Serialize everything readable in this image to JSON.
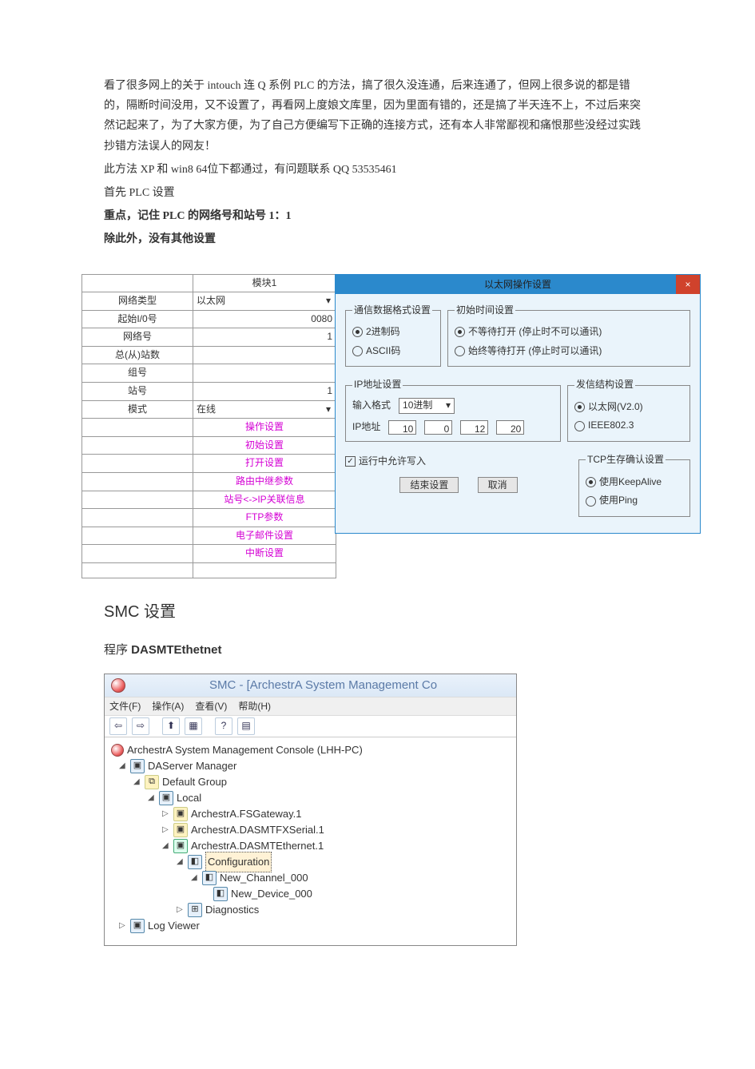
{
  "text": {
    "p1": "看了很多网上的关于 intouch 连 Q 系例 PLC 的方法，搞了很久没连通，后来连通了，但网上很多说的都是错的，隔断时间没用，又不设置了，再看网上度娘文库里，因为里面有错的，还是搞了半天连不上，不过后来突然记起来了，为了大家方便，为了自己方便编写下正确的连接方式，还有本人非常鄙视和痛恨那些没经过实践抄错方法误人的网友！",
    "p2a": "此方法 XP 和 win8",
    "p2b": "64位下都通过，有问题联系 QQ",
    "p2c": "53535461",
    "p3": "首先 PLC 设置",
    "p4": "重点，记住 PLC 的网络号和站号  1：1",
    "p5": "除此外，没有其他设置",
    "smc_h": "SMC 设置",
    "prog_pre": "程序 ",
    "prog_name": "DASMTEthetnet"
  },
  "plc": {
    "header_module": "模块1",
    "rows": {
      "net_type_lbl": "网络类型",
      "net_type_val": "以太网",
      "start_io_lbl": "起始I/0号",
      "start_io_val": "0080",
      "net_no_lbl": "网络号",
      "net_no_val": "1",
      "total_sta_lbl": "总(从)站数",
      "total_sta_val": "",
      "group_lbl": "组号",
      "group_val": "",
      "sta_lbl": "站号",
      "sta_val": "1",
      "mode_lbl": "模式",
      "mode_val": "在线"
    },
    "links": [
      "操作设置",
      "初始设置",
      "打开设置",
      "路由中继参数",
      "站号<->IP关联信息",
      "FTP参数",
      "电子邮件设置",
      "中断设置"
    ]
  },
  "dlg": {
    "title": "以太网操作设置",
    "close": "×",
    "fmt_legend": "通信数据格式设置",
    "fmt_bin": "2进制码",
    "fmt_ascii": "ASCII码",
    "init_legend": "初始时间设置",
    "init_nowait": "不等待打开 (停止时不可以通讯)",
    "init_wait": "始终等待打开 (停止时可以通讯)",
    "ip_legend": "IP地址设置",
    "ip_fmt_lbl": "输入格式",
    "ip_fmt_val": "10进制",
    "ip_lbl": "IP地址",
    "ip": [
      "10",
      "0",
      "12",
      "20"
    ],
    "send_legend": "发信结构设置",
    "send_v2": "以太网(V2.0)",
    "send_ieee": "IEEE802.3",
    "writable": "运行中允许写入",
    "tcp_legend": "TCP生存确认设置",
    "tcp_keep": "使用KeepAlive",
    "tcp_ping": "使用Ping",
    "btn_end": "结束设置",
    "btn_cancel": "取消"
  },
  "smc": {
    "title": "SMC - [ArchestrA System Management Co",
    "menu": [
      "文件(F)",
      "操作(A)",
      "查看(V)",
      "帮助(H)"
    ],
    "nodes": {
      "root": "ArchestrA System Management Console (LHH-PC)",
      "daserver": "DAServer Manager",
      "defgroup": "Default Group",
      "local": "Local",
      "fsgateway": "ArchestrA.FSGateway.1",
      "dasmtfx": "ArchestrA.DASMTFXSerial.1",
      "dasmteth": "ArchestrA.DASMTEthernet.1",
      "config": "Configuration",
      "channel": "New_Channel_000",
      "device": "New_Device_000",
      "diag": "Diagnostics",
      "logviewer": "Log Viewer"
    }
  }
}
